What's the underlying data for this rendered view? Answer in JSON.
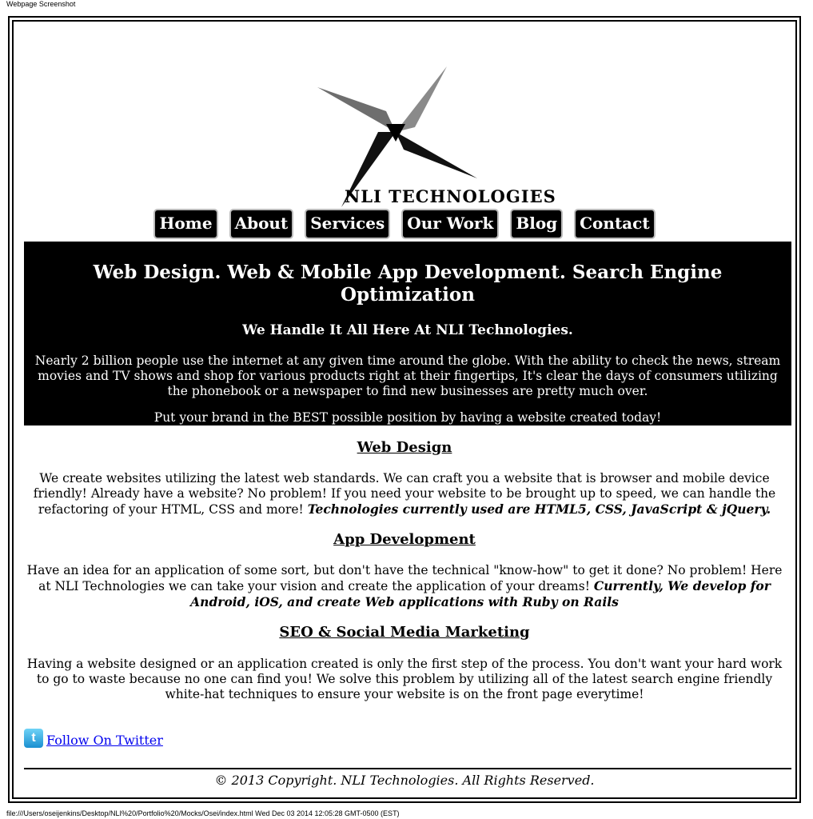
{
  "print": {
    "header": "Webpage Screenshot",
    "footer": "file:///Users/oseijenkins/Desktop/NLI%20/Portfolio%20/Mocks/Osei/index.html Wed Dec 03 2014 12:05:28 GMT-0500 (EST)"
  },
  "logo": {
    "text": "NLI TECHNOLOGIES"
  },
  "nav": [
    "Home",
    "About",
    "Services",
    "Our Work",
    "Blog",
    "Contact"
  ],
  "hero": {
    "title": "Web Design. Web & Mobile App Development. Search Engine Optimization",
    "subtitle": "We Handle It All Here At NLI Technologies.",
    "paragraph1": "Nearly 2 billion people use the internet at any given time around the globe. With the ability to check the news, stream movies and TV shows and shop for various products right at their fingertips, It's clear the days of consumers utilizing the phonebook or a newspaper to find new businesses are pretty much over.",
    "paragraph2": "Put your brand in the BEST possible position by having a website created today!"
  },
  "sections": [
    {
      "title": "Web Design",
      "body": "We create websites utilizing the latest web standards. We can craft you a website that is browser and mobile device friendly! Already have a website? No problem! If you need your website to be brought up to speed, we can handle the refactoring of your HTML, CSS and more! ",
      "emphasis": "Technologies currently used are HTML5, CSS, JavaScript & jQuery."
    },
    {
      "title": "App Development",
      "body": "Have an idea for an application of some sort, but don't have the technical \"know-how\" to get it done? No problem! Here at NLI Technologies we can take your vision and create the application of your dreams! ",
      "emphasis": "Currently, We develop for Android, iOS, and create Web applications with Ruby on Rails"
    },
    {
      "title": "SEO & Social Media Marketing",
      "body": "Having a website designed or an application created is only the first step of the process. You don't want your hard work to go to waste because no one can find you! We solve this problem by utilizing all of the latest search engine friendly white-hat techniques to ensure your website is on the front page everytime!",
      "emphasis": ""
    }
  ],
  "social": {
    "icon": "twitter-icon",
    "icon_glyph": "t",
    "link": "Follow On Twitter"
  },
  "footer": {
    "copyright": "© 2013 Copyright. NLI Technologies. All Rights Reserved."
  }
}
